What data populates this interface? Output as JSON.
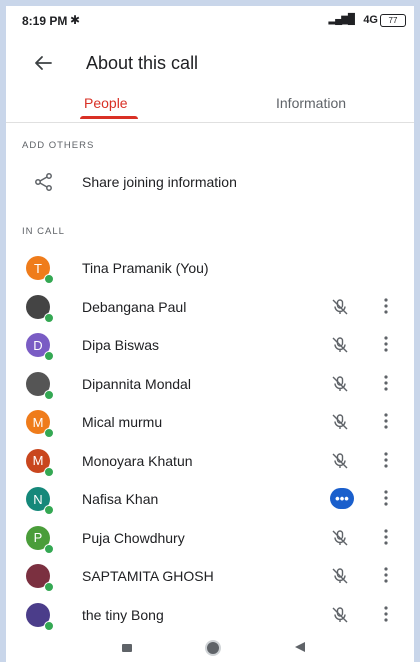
{
  "status_bar": {
    "time": "8:19 PM",
    "network": "4G",
    "battery": "77"
  },
  "app_bar": {
    "title": "About this call",
    "back_icon": "arrow-left-icon"
  },
  "tabs": [
    {
      "label": "People",
      "active": true
    },
    {
      "label": "Information",
      "active": false
    }
  ],
  "add_others": {
    "header": "ADD OTHERS",
    "share_label": "Share joining information",
    "icon": "share-icon"
  },
  "in_call": {
    "header": "IN CALL",
    "participants": [
      {
        "name": "Tina Pramanik (You)",
        "initial": "T",
        "color": "#ef7c1b",
        "photo": false,
        "action": "none"
      },
      {
        "name": "Debangana Paul",
        "initial": "",
        "color": "#444444",
        "photo": true,
        "action": "muted"
      },
      {
        "name": "Dipa Biswas",
        "initial": "D",
        "color": "#7a5cc4",
        "photo": false,
        "action": "muted"
      },
      {
        "name": "Dipannita Mondal",
        "initial": "",
        "color": "#555555",
        "photo": true,
        "action": "muted"
      },
      {
        "name": "Mical murmu",
        "initial": "M",
        "color": "#ef7c1b",
        "photo": false,
        "action": "muted"
      },
      {
        "name": "Monoyara Khatun",
        "initial": "M",
        "color": "#c9461e",
        "photo": false,
        "action": "muted"
      },
      {
        "name": "Nafisa Khan",
        "initial": "N",
        "color": "#15887a",
        "photo": false,
        "action": "talking"
      },
      {
        "name": "Puja Chowdhury",
        "initial": "P",
        "color": "#4a9d3a",
        "photo": false,
        "action": "muted"
      },
      {
        "name": "SAPTAMITA GHOSH",
        "initial": "",
        "color": "#7b3040",
        "photo": true,
        "action": "muted"
      },
      {
        "name": "the tiny Bong",
        "initial": "",
        "color": "#4b3d8a",
        "photo": true,
        "action": "muted"
      }
    ]
  },
  "colors": {
    "accent": "#d93025",
    "talking_badge": "#1a5fcc",
    "presence": "#34a853"
  }
}
